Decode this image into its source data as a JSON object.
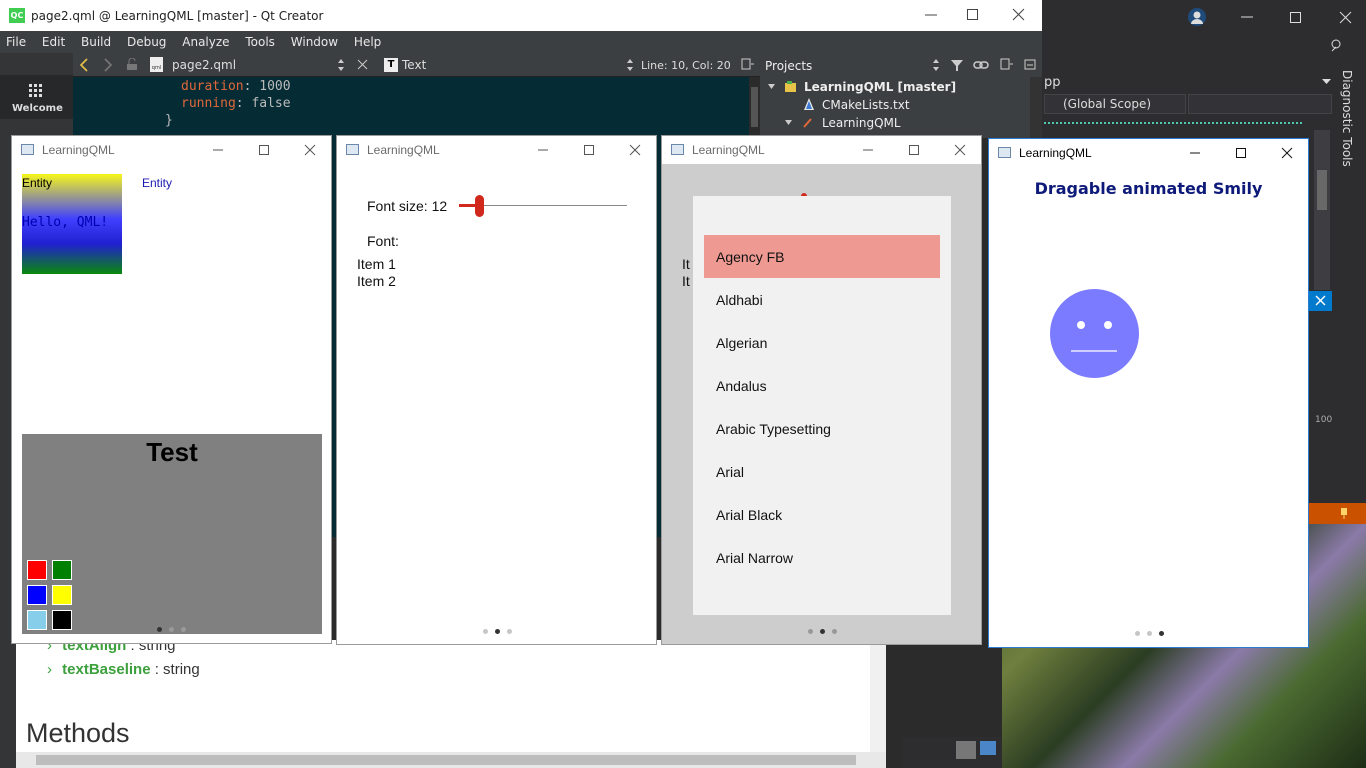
{
  "qtcreator": {
    "title": "page2.qml @ LearningQML [master] - Qt Creator",
    "menu": [
      "File",
      "Edit",
      "Build",
      "Debug",
      "Analyze",
      "Tools",
      "Window",
      "Help"
    ],
    "toolbar": {
      "file": "page2.qml",
      "type_label": "Text",
      "position": "Line: 10, Col: 20"
    },
    "modes": {
      "welcome": "Welcome"
    },
    "code": [
      {
        "key": "duration",
        "sep": ": ",
        "value": "1000"
      },
      {
        "key": "running",
        "sep": ": ",
        "value": "false"
      },
      {
        "brace": "}"
      }
    ],
    "projects": {
      "label": "Projects",
      "root": "LearningQML [master]",
      "items": [
        "CMakeLists.txt",
        "LearningQML"
      ]
    }
  },
  "vs": {
    "file_fragment": "pp",
    "scope": "(Global Scope)",
    "diagnostic_tools": "Diagnostic Tools",
    "value_100": "100"
  },
  "doc": {
    "props": [
      {
        "name": "textAlign",
        "type": " : string"
      },
      {
        "name": "textBaseline",
        "type": " : string"
      }
    ],
    "methods": "Methods"
  },
  "windows": {
    "w1": {
      "title": "LearningQML",
      "entity1": "Entity",
      "entity2": "Entity",
      "hello": "Hello, QML!",
      "test": "Test",
      "swatches": [
        "#ff0000",
        "#008000",
        "#0000ff",
        "#ffff00",
        "#87ceeb",
        "#000000"
      ]
    },
    "w2": {
      "title": "LearningQML",
      "font_size_label": "Font size: 12",
      "font_size_value": 12,
      "font_label": "Font:",
      "items": [
        "Item 1",
        "Item 2"
      ]
    },
    "w3": {
      "title": "LearningQML",
      "partial_items": [
        "It",
        "It"
      ],
      "fonts": [
        "Agency FB",
        "Aldhabi",
        "Algerian",
        "Andalus",
        "Arabic Typesetting",
        "Arial",
        "Arial Black",
        "Arial Narrow"
      ],
      "selected_index": 0,
      "selected_color": "#ee9a92"
    },
    "w4": {
      "title": "LearningQML",
      "heading": "Dragable animated Smily",
      "smily_color": "#7b7bff"
    }
  }
}
